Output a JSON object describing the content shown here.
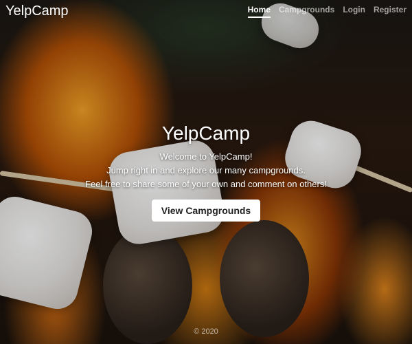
{
  "header": {
    "brand": "YelpCamp",
    "nav": {
      "home": "Home",
      "campgrounds": "Campgrounds",
      "login": "Login",
      "register": "Register"
    }
  },
  "hero": {
    "title": "YelpCamp",
    "line1": "Welcome to YelpCamp!",
    "line2": "Jump right in and explore our many campgrounds.",
    "line3": "Feel free to share some of your own and comment on others!",
    "button": "View Campgrounds"
  },
  "footer": {
    "copyright": "© 2020"
  },
  "colors": {
    "accent": "#ffffff",
    "fire": "#ff9a1f"
  }
}
